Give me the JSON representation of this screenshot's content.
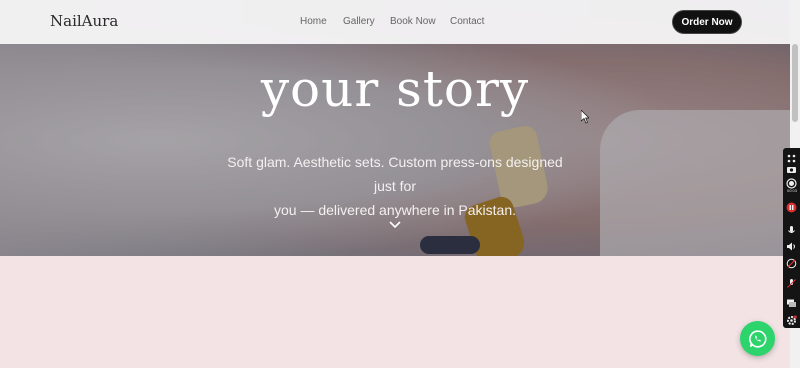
{
  "nav": {
    "logo": "NailAura",
    "links": [
      "Home",
      "Gallery",
      "Book Now",
      "Contact"
    ],
    "cta": "Order Now"
  },
  "hero": {
    "title": "your story",
    "subtitle_line1": "Soft glam. Aesthetic sets. Custom press-ons designed just for",
    "subtitle_line2": "you — delivered anywhere in Pakistan.",
    "scroll_icon": "chevron-down-icon"
  },
  "recorder": {
    "time": "00:03",
    "icons": [
      "move-icon",
      "camera-icon",
      "record-icon",
      "pause-icon",
      "microphone-icon",
      "speaker-icon",
      "webcam-icon",
      "mic-off-icon",
      "screens-icon",
      "settings-icon"
    ]
  },
  "floating": {
    "whatsapp_icon": "whatsapp-icon"
  },
  "colors": {
    "page_bg": "#f3e3e4",
    "button_bg": "#111111",
    "whatsapp": "#2cd46b"
  }
}
